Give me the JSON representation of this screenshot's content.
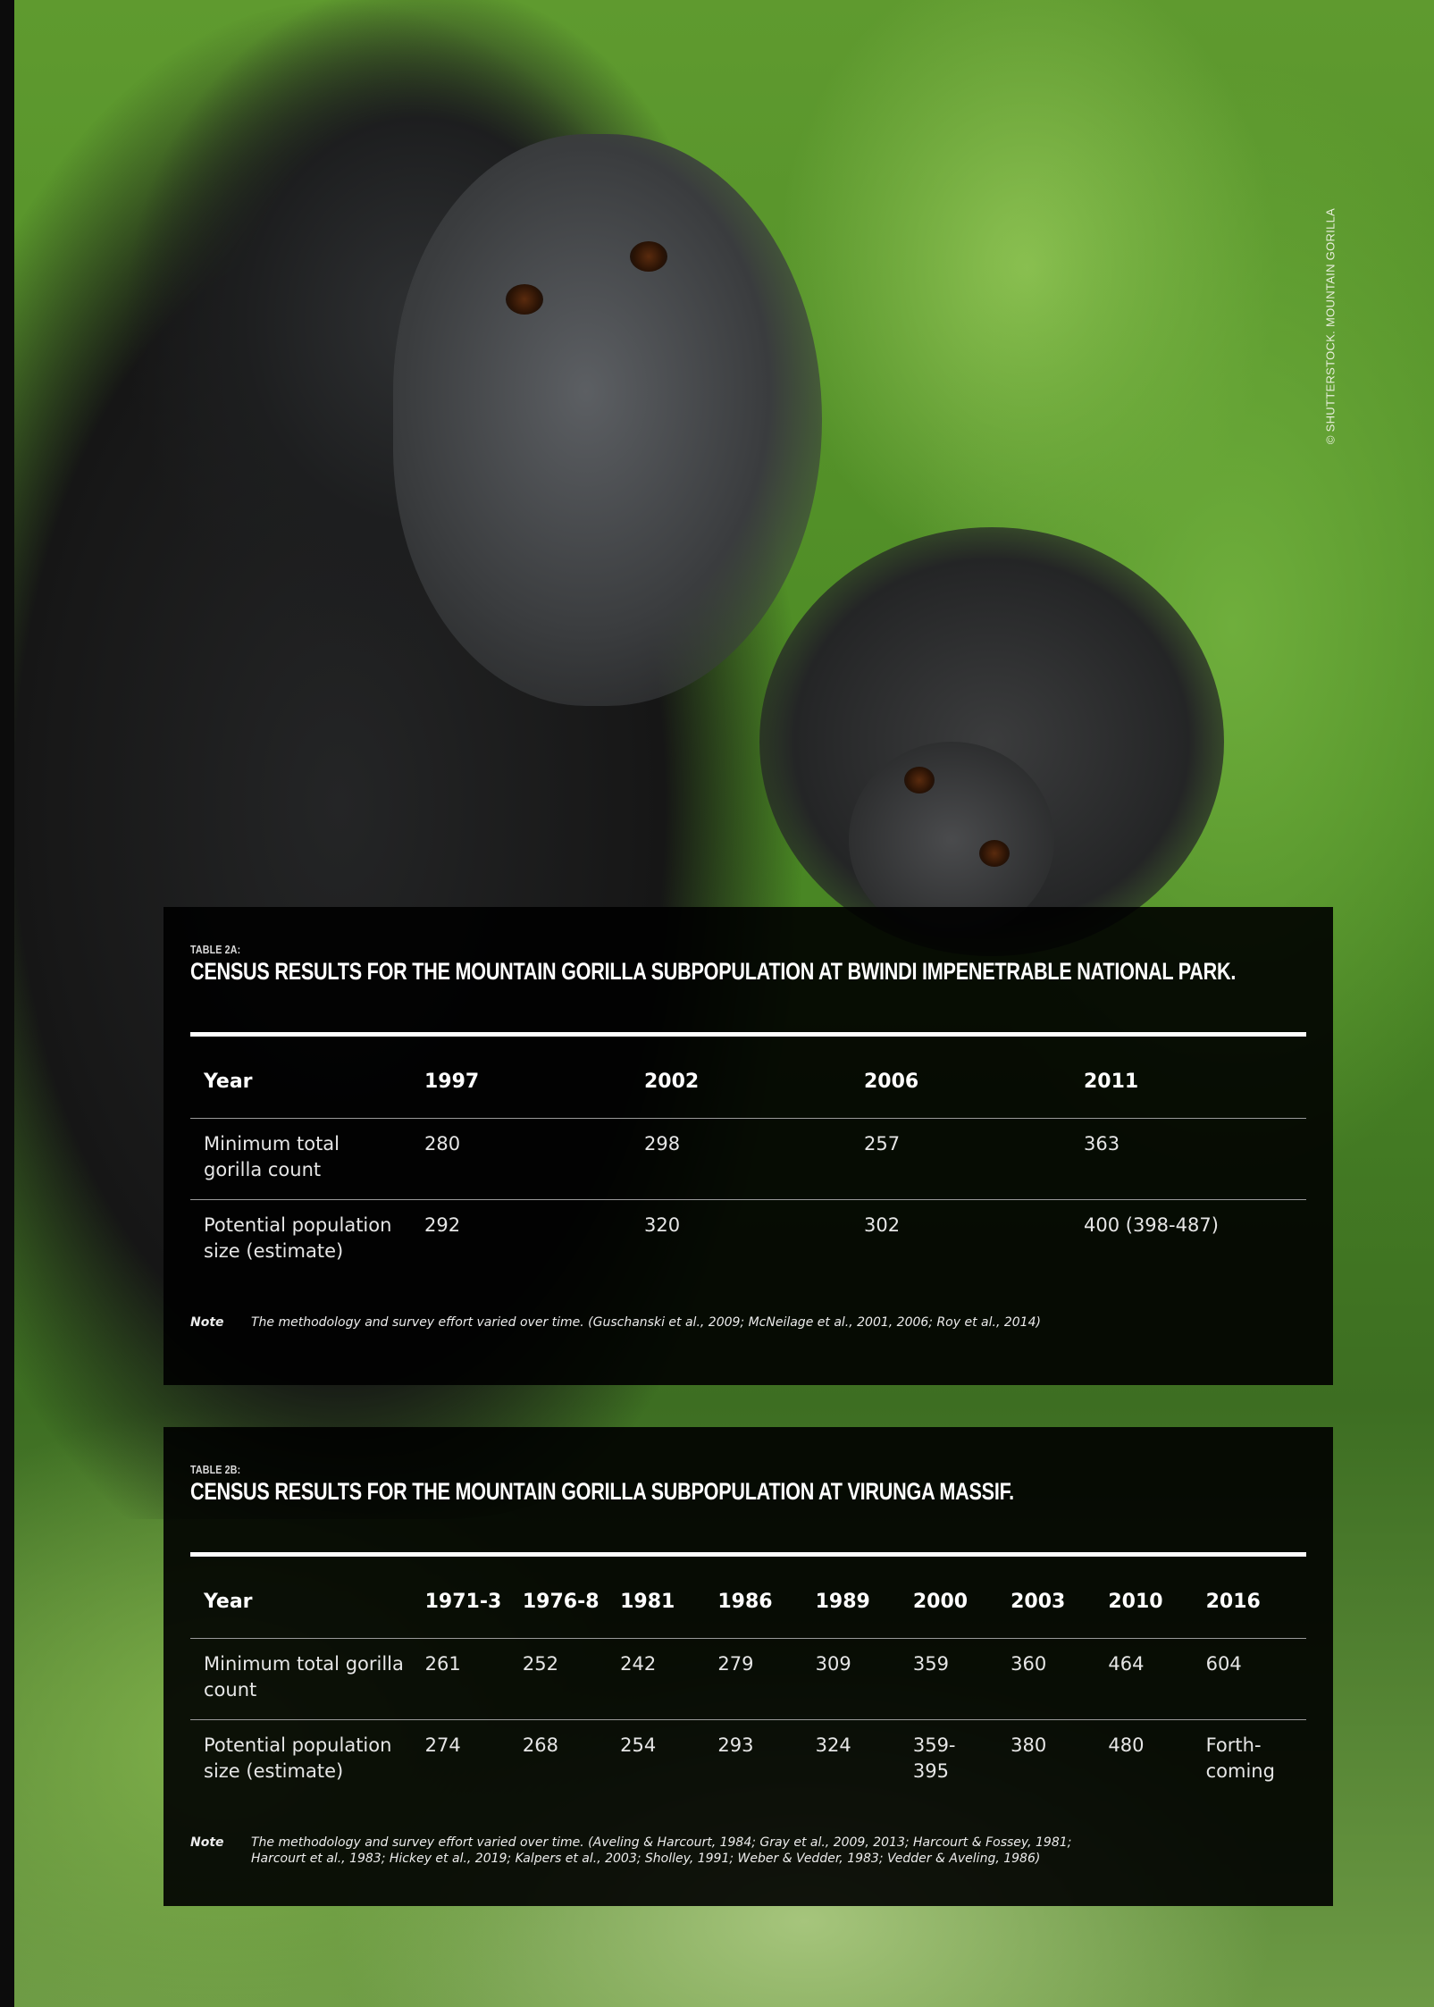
{
  "photo_credit": "© SHUTTERSTOCK. MOUNTAIN GORILLA",
  "colors": {
    "panel_background": "#000000",
    "text": "#ffffff",
    "foliage": "#5f9a2f"
  },
  "table_2a": {
    "label": "TABLE 2A:",
    "title": "CENSUS RESULTS FOR THE MOUNTAIN GORILLA SUBPOPULATION AT BWINDI IMPENETRABLE NATIONAL PARK.",
    "header": [
      "Year",
      "1997",
      "2002",
      "2006",
      "2011"
    ],
    "rows": [
      [
        "Minimum total gorilla count",
        "280",
        "298",
        "257",
        "363"
      ],
      [
        "Potential population size (estimate)",
        "292",
        "320",
        "302",
        "400 (398-487)"
      ]
    ],
    "note_label": "Note",
    "note": "The methodology and survey effort varied over time. (Guschanski et al., 2009; McNeilage et al., 2001, 2006; Roy et al., 2014)"
  },
  "table_2b": {
    "label": "TABLE 2B:",
    "title": "CENSUS RESULTS FOR THE MOUNTAIN GORILLA SUBPOPULATION AT VIRUNGA MASSIF.",
    "header": [
      "Year",
      "1971-3",
      "1976-8",
      "1981",
      "1986",
      "1989",
      "2000",
      "2003",
      "2010",
      "2016"
    ],
    "rows": [
      [
        "Minimum total gorilla count",
        "261",
        "252",
        "242",
        "279",
        "309",
        "359",
        "360",
        "464",
        "604"
      ],
      [
        "Potential population size (estimate)",
        "274",
        "268",
        "254",
        "293",
        "324",
        "359-395",
        "380",
        "480",
        "Forth-coming"
      ]
    ],
    "note_label": "Note",
    "note_line1": "The methodology and survey effort varied over time. (Aveling & Harcourt, 1984; Gray et al., 2009, 2013; Harcourt & Fossey, 1981;",
    "note_line2": "Harcourt et al., 1983; Hickey et al., 2019; Kalpers et al., 2003; Sholley, 1991; Weber & Vedder, 1983; Vedder & Aveling, 1986)"
  }
}
